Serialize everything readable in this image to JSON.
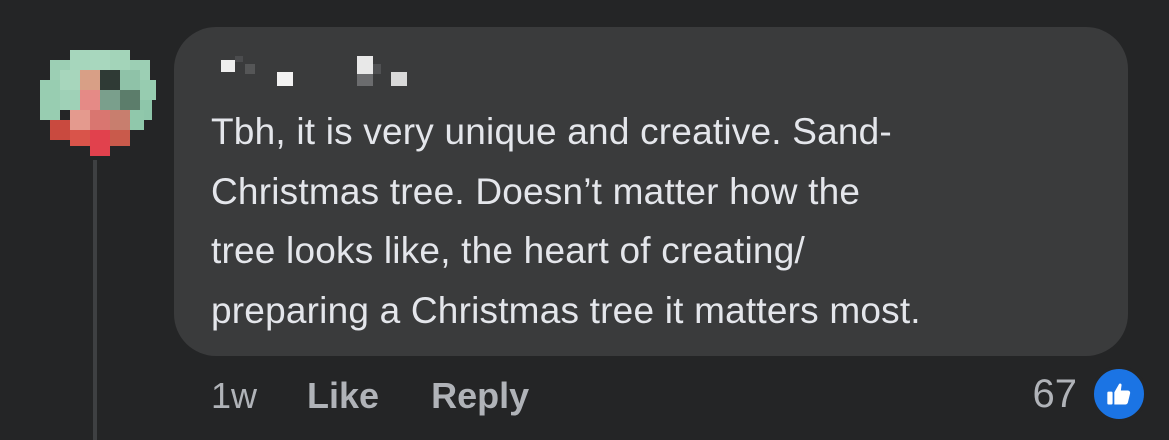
{
  "comment": {
    "author_name": "",
    "text_lines": [
      "Tbh, it is very unique and creative. Sand-",
      "Christmas tree. Doesn’t matter how the",
      "tree looks like, the heart of creating/",
      "preparing a Christmas tree it matters most."
    ],
    "timestamp": "1w",
    "like_label": "Like",
    "reply_label": "Reply",
    "reaction_count": "67",
    "reaction_icon": "thumbs-up-icon"
  },
  "colors": {
    "background": "#242526",
    "bubble": "#3a3b3c",
    "text": "#e4e6eb",
    "secondary_text": "#b0b3b8",
    "like_blue": "#1b74e4"
  }
}
